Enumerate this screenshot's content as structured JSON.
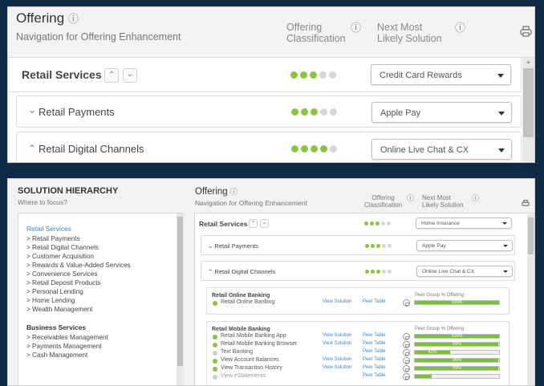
{
  "top": {
    "title": "Offering",
    "subtitle": "Navigation for Offering Enhancement",
    "col_classification": [
      "Offering",
      "Classification"
    ],
    "col_next": [
      "Next Most",
      "Likely Solution"
    ],
    "rows": [
      {
        "label": "Retail Services",
        "dots_on": 3,
        "dots_total": 5,
        "selected": "Credit Card Rewards"
      },
      {
        "label": "Retail Payments",
        "dots_on": 3,
        "dots_total": 5,
        "selected": "Apple Pay"
      },
      {
        "label": "Retail Digital Channels",
        "dots_on": 4,
        "dots_total": 5,
        "selected": "Online Live Chat & CX"
      }
    ]
  },
  "hierarchy": {
    "title": "SOLUTION HIERARCHY",
    "subtitle": "Where to focus?",
    "groups": [
      {
        "header": "Retail Services",
        "active": true,
        "items": [
          "> Retail Payments",
          "> Retail Digital Channels",
          "> Customer Acquisition",
          "> Rewards & Value-Added Services",
          "> Convenience Services",
          "> Retail Deposit Products",
          "> Personal Lending",
          "> Home Lending",
          "> Wealth Management"
        ]
      },
      {
        "header": "Business Services",
        "active": false,
        "items": [
          "> Receivables Management",
          "> Payments Management",
          "> Cash Management"
        ]
      }
    ]
  },
  "bottom": {
    "title": "Offering",
    "subtitle": "Navigation for Offering Enhancement",
    "col_classification": [
      "Offering",
      "Classification"
    ],
    "col_next": [
      "Next Most",
      "Likely Solution"
    ],
    "rows": [
      {
        "label": "Retail Services",
        "dots_on": 3,
        "dots_total": 5,
        "selected": "Home Insurance"
      },
      {
        "label": "Retail Payments",
        "dots_on": 3,
        "dots_total": 5,
        "selected": "Apple Pay"
      },
      {
        "label": "Retail Digital Channels",
        "dots_on": 3,
        "dots_total": 5,
        "selected": "Online Live Chat & CX"
      }
    ],
    "online_banking": {
      "title": "Retail Online Banking",
      "peer_header": "Peer Group % Offering",
      "items": [
        {
          "label": "Retail Online Banking",
          "view": "View Solution",
          "peer": "Peer Table",
          "pct": 100,
          "pct_label": "100%",
          "on": true
        }
      ]
    },
    "mobile_banking": {
      "title": "Retail Mobile Banking",
      "peer_header": "Peer Group % Offering",
      "items": [
        {
          "label": "Retail Mobile Banking App",
          "view": "View Solution",
          "peer": "Peer Table",
          "pct": 100,
          "pct_label": "100%",
          "on": true
        },
        {
          "label": "Retail Mobile Banking Browser",
          "view": "View Solution",
          "peer": "Peer Table",
          "pct": 99,
          "pct_label": "99%",
          "on": true
        },
        {
          "label": "Text Banking",
          "view": "",
          "peer": "Peer Table",
          "pct": 42,
          "pct_label": "42%",
          "on": false
        },
        {
          "label": "View Account Balances",
          "view": "View Solution",
          "peer": "Peer Table",
          "pct": 99,
          "pct_label": "99%",
          "on": true
        },
        {
          "label": "View Transaction History",
          "view": "View Solution",
          "peer": "Peer Table",
          "pct": 99,
          "pct_label": "99%",
          "on": true
        },
        {
          "label": "View eStatements",
          "view": "",
          "peer": "Peer Table",
          "pct": 20,
          "pct_label": "",
          "on": false
        }
      ]
    }
  }
}
